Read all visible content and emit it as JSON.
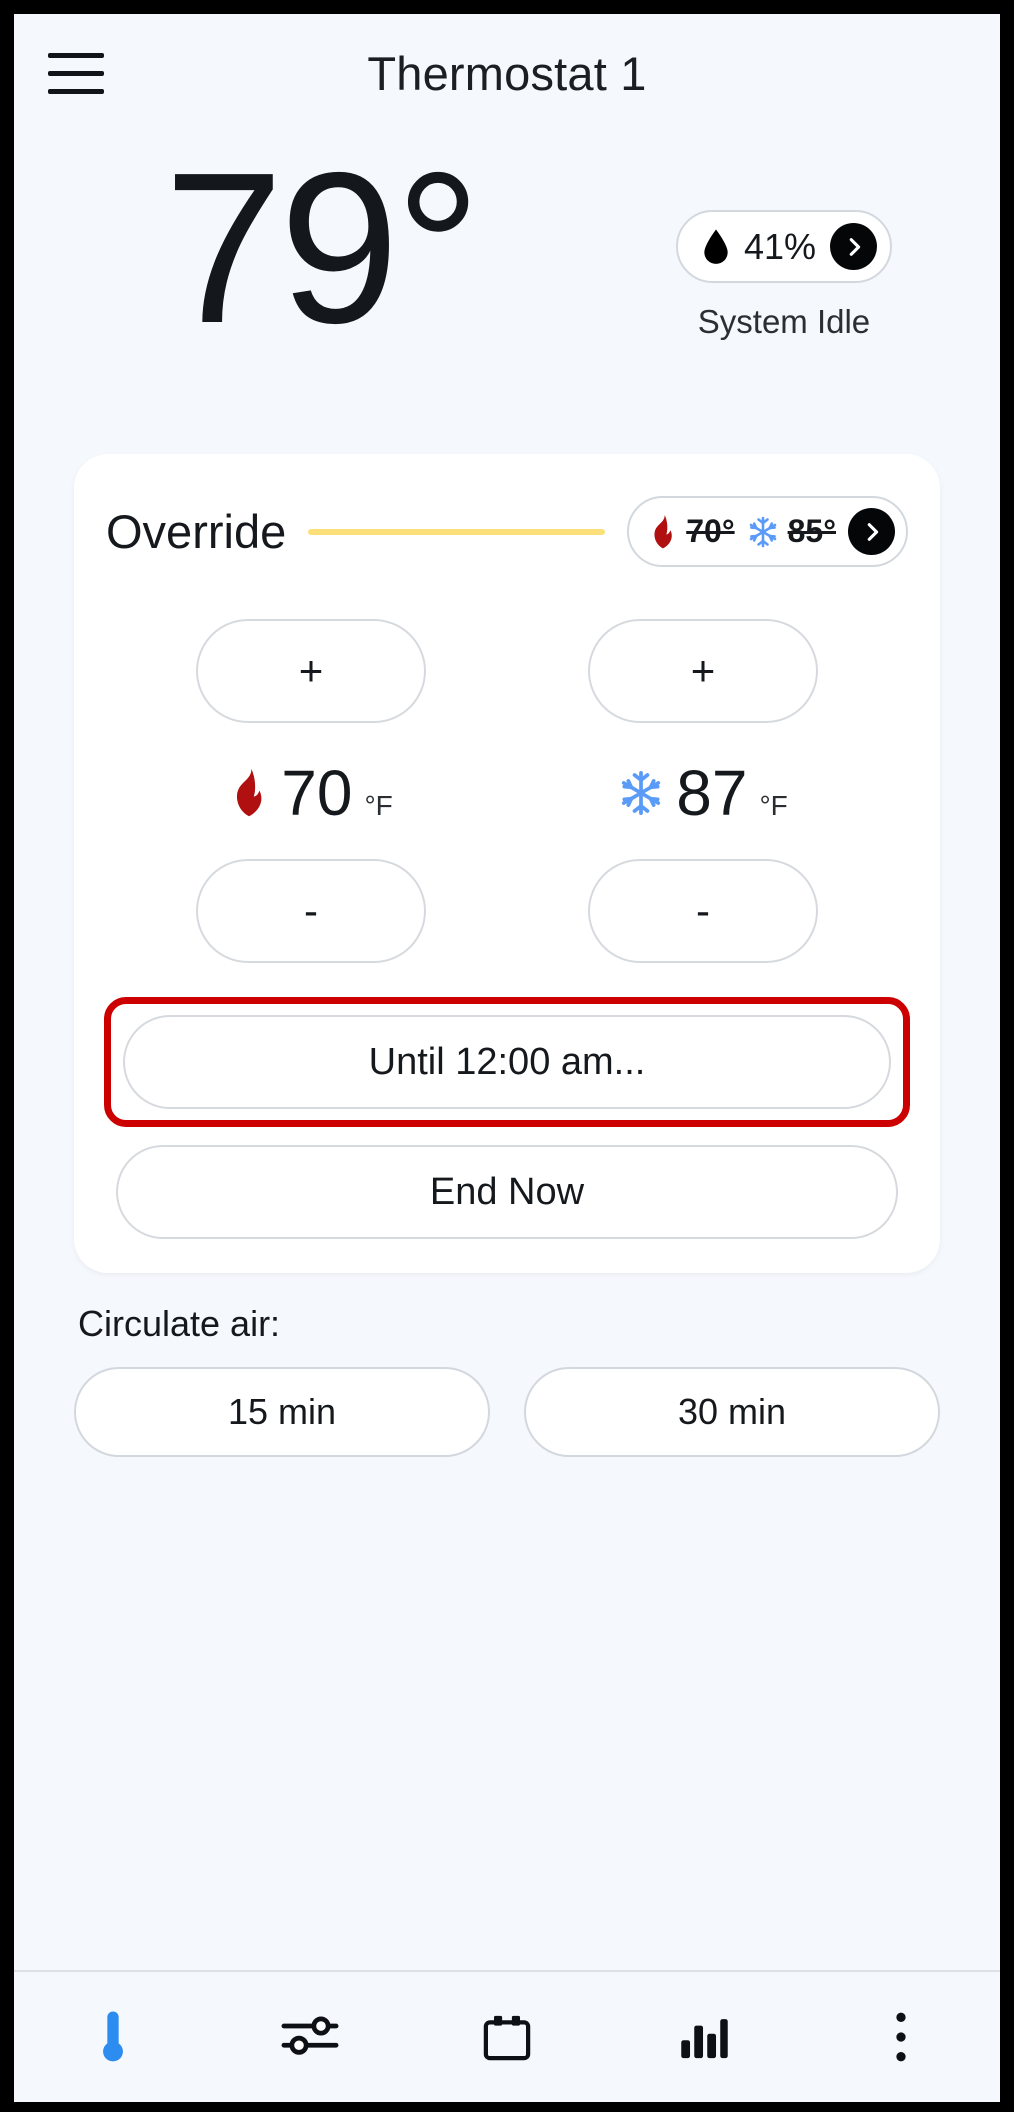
{
  "header": {
    "title": "Thermostat 1",
    "menu_icon": "hamburger-menu-icon"
  },
  "hero": {
    "current_temperature": "79°",
    "humidity": "41%",
    "humidity_icon": "water-drop-icon",
    "humidity_chevron_icon": "chevron-right-icon",
    "system_status": "System Idle"
  },
  "override_card": {
    "title": "Override",
    "accent_color": "#fbe079",
    "schedule_pill": {
      "heat_icon": "flame-icon",
      "heat_value": "70°",
      "cool_icon": "snowflake-icon",
      "cool_value": "85°",
      "chevron_icon": "chevron-right-icon"
    },
    "heat": {
      "increase_label": "+",
      "decrease_label": "-",
      "icon": "flame-icon",
      "value": "70",
      "unit": "°F"
    },
    "cool": {
      "increase_label": "+",
      "decrease_label": "-",
      "icon": "snowflake-icon",
      "value": "87",
      "unit": "°F"
    },
    "until_label": "Until 12:00 am...",
    "until_highlight_color": "#cc0000",
    "end_now_label": "End Now"
  },
  "circulate": {
    "label": "Circulate air:",
    "options": [
      {
        "label": "15 min"
      },
      {
        "label": "30 min"
      }
    ]
  },
  "bottom_nav": {
    "items": [
      {
        "name": "thermostat-tab",
        "icon": "thermometer-icon",
        "active": true
      },
      {
        "name": "settings-tab",
        "icon": "sliders-icon",
        "active": false
      },
      {
        "name": "schedule-tab",
        "icon": "calendar-icon",
        "active": false
      },
      {
        "name": "usage-tab",
        "icon": "bar-chart-icon",
        "active": false
      },
      {
        "name": "more-tab",
        "icon": "overflow-menu-icon",
        "active": false
      }
    ],
    "active_color": "#2d8cf0"
  }
}
